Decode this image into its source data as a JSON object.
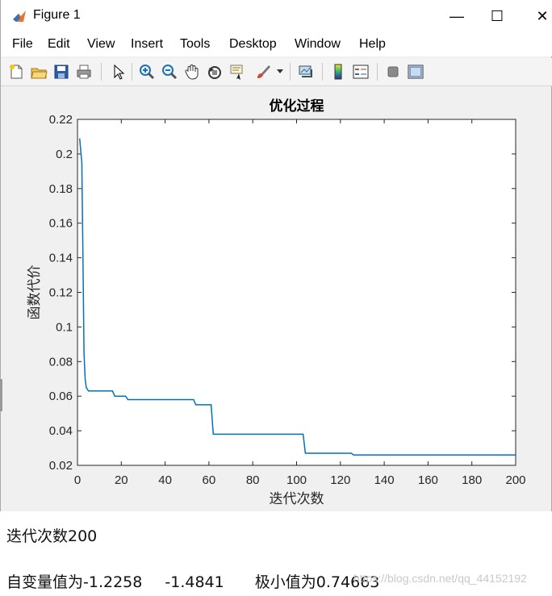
{
  "window": {
    "title": "Figure 1",
    "minimize": "—",
    "maximize": "☐",
    "close": "✕"
  },
  "menu": [
    "File",
    "Edit",
    "View",
    "Insert",
    "Tools",
    "Desktop",
    "Window",
    "Help"
  ],
  "toolbar": {
    "icons": [
      "new-figure-icon",
      "open-file-icon",
      "save-icon",
      "print-icon",
      "pointer-icon",
      "zoom-in-icon",
      "zoom-out-icon",
      "pan-hand-icon",
      "rotate-3d-icon",
      "data-cursor-icon",
      "brush-icon",
      "link-plot-icon",
      "colorbar-icon",
      "legend-icon",
      "hide-plot-tools-icon",
      "show-plot-tools-icon"
    ]
  },
  "chart_data": {
    "type": "line",
    "title": "优化过程",
    "xlabel": "迭代次数",
    "ylabel": "函数代价",
    "xlim": [
      0,
      200
    ],
    "ylim": [
      0.02,
      0.22
    ],
    "xticks": [
      0,
      20,
      40,
      60,
      80,
      100,
      120,
      140,
      160,
      180,
      200
    ],
    "yticks": [
      "0.02",
      "0.04",
      "0.06",
      "0.08",
      "0.1",
      "0.12",
      "0.14",
      "0.16",
      "0.18",
      "0.2",
      "0.22"
    ],
    "grid": false,
    "line_color": "#0072bd",
    "series": [
      {
        "x": [
          1,
          2,
          2.5,
          3,
          3.5,
          4,
          5,
          6,
          10,
          16,
          17,
          22,
          23,
          40,
          53,
          54,
          60,
          61,
          62,
          103,
          104,
          105,
          125,
          126,
          200
        ],
        "y": [
          0.209,
          0.195,
          0.14,
          0.085,
          0.07,
          0.065,
          0.063,
          0.063,
          0.063,
          0.063,
          0.06,
          0.06,
          0.058,
          0.058,
          0.058,
          0.055,
          0.055,
          0.055,
          0.038,
          0.038,
          0.027,
          0.027,
          0.027,
          0.026,
          0.026
        ]
      }
    ]
  },
  "output": {
    "line1": "迭代次数200",
    "line2_prefix": "自变量值为-1.2258",
    "line2_value2": "-1.4841",
    "line2_min": "极小值为0.74663"
  },
  "watermark": "https://blog.csdn.net/qq_44152192"
}
